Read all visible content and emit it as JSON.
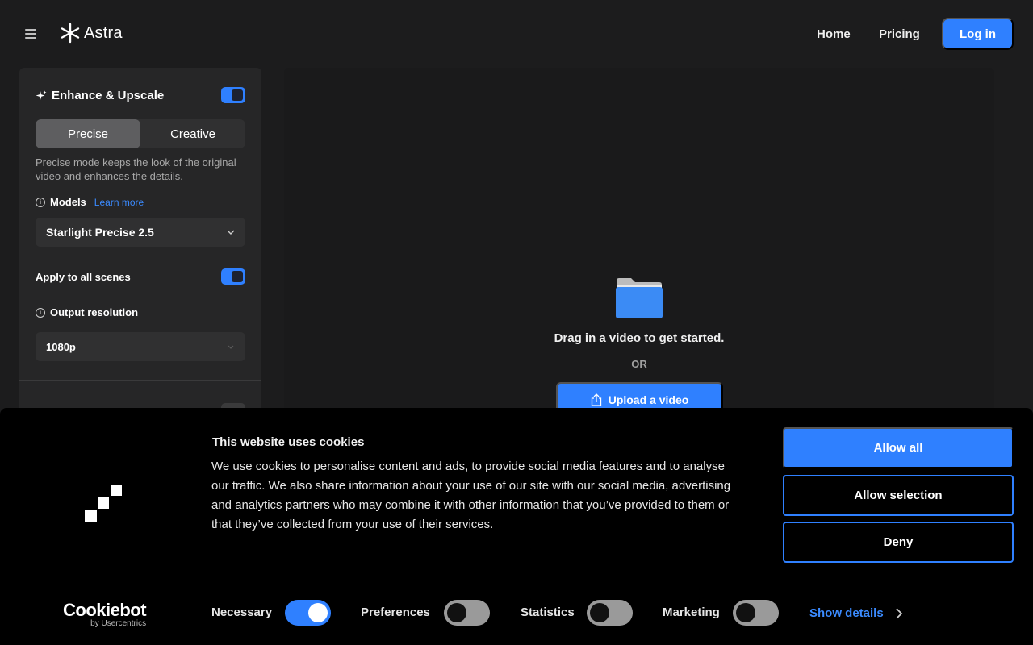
{
  "header": {
    "brand": "Astra",
    "nav": {
      "home": "Home",
      "pricing": "Pricing"
    },
    "login_label": "Log in"
  },
  "panel": {
    "enhance_title": "Enhance & Upscale",
    "enhance_enabled": true,
    "modes": {
      "precise": "Precise",
      "creative": "Creative",
      "selected": "Precise"
    },
    "description": "Precise mode keeps the look of the original video and enhances the details.",
    "models_label": "Models",
    "learn_more": "Learn more",
    "model_value": "Starlight Precise 2.5",
    "apply_label": "Apply to all scenes",
    "apply_enabled": true,
    "output_label": "Output resolution",
    "output_value": "1080p"
  },
  "dropzone": {
    "drag_text": "Drag in a video to get started.",
    "or_text": "OR",
    "upload_label": "Upload a video"
  },
  "cookie": {
    "title": "This website uses cookies",
    "body": "We use cookies to personalise content and ads, to provide social media features and to analyse our traffic. We also share information about your use of our site with our social media, advertising and analytics partners who may combine it with other information that you’ve provided to them or that they’ve collected from your use of their services.",
    "allow_all": "Allow all",
    "allow_selection": "Allow selection",
    "deny": "Deny",
    "categories": {
      "necessary": "Necessary",
      "preferences": "Preferences",
      "statistics": "Statistics",
      "marketing": "Marketing"
    },
    "show_details": "Show details",
    "brand_name": "Cookiebot",
    "brand_sub": "by Usercentrics"
  },
  "colors": {
    "accent": "#2f80ff",
    "background": "#1c1c1d",
    "banner": "#000000"
  }
}
